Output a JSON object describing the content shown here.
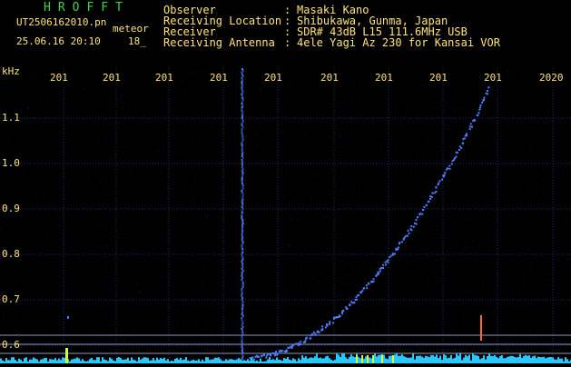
{
  "header": {
    "app_title": "HROFFT",
    "file_name": "UT2506162010.pn",
    "file_tag": "meteor",
    "date_time": "25.06.16 20:10",
    "number": "18_"
  },
  "info": [
    {
      "label": "Observer",
      "value": "Masaki Kano"
    },
    {
      "label": "Receiving Location",
      "value": "Shibukawa, Gunma, Japan"
    },
    {
      "label": "Receiver",
      "value": "SDR# 43dB L15 111.6MHz USB"
    },
    {
      "label": "Receiving Antenna",
      "value": "4ele Yagi Az 230 for Kansai VOR"
    }
  ],
  "info_separator": ":",
  "plot": {
    "y_unit": "kHz",
    "y_ticks": [
      "1.1",
      "1.0",
      "0.9",
      "0.8",
      "0.7",
      "0.6"
    ],
    "x_ticks": [
      "201",
      "201",
      "201",
      "201",
      "201",
      "201",
      "201",
      "201",
      "201",
      "2020"
    ],
    "colors": {
      "background": "#000000",
      "grid": "#1c2a6e",
      "tick_label": "#ffe27a",
      "signal": "#4f7dff",
      "baseline": "#28c8ff",
      "marker": "#c9ff3f"
    }
  }
}
